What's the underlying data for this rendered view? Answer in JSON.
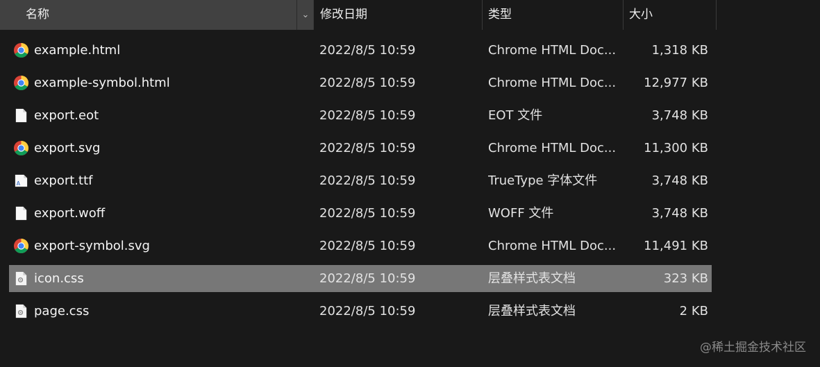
{
  "header": {
    "name": "名称",
    "modified": "修改日期",
    "type": "类型",
    "size": "大小",
    "sort_indicator": "^",
    "dropdown": "⌄"
  },
  "files": [
    {
      "name": "example.html",
      "modified": "2022/8/5 10:59",
      "type": "Chrome HTML Doc...",
      "size": "1,318 KB",
      "icon": "chrome-icon",
      "selected": false
    },
    {
      "name": "example-symbol.html",
      "modified": "2022/8/5 10:59",
      "type": "Chrome HTML Doc...",
      "size": "12,977 KB",
      "icon": "chrome-icon",
      "selected": false
    },
    {
      "name": "export.eot",
      "modified": "2022/8/5 10:59",
      "type": "EOT 文件",
      "size": "3,748 KB",
      "icon": "file-icon",
      "selected": false
    },
    {
      "name": "export.svg",
      "modified": "2022/8/5 10:59",
      "type": "Chrome HTML Doc...",
      "size": "11,300 KB",
      "icon": "chrome-icon",
      "selected": false
    },
    {
      "name": "export.ttf",
      "modified": "2022/8/5 10:59",
      "type": "TrueType 字体文件",
      "size": "3,748 KB",
      "icon": "font-file-icon",
      "selected": false
    },
    {
      "name": "export.woff",
      "modified": "2022/8/5 10:59",
      "type": "WOFF 文件",
      "size": "3,748 KB",
      "icon": "file-icon",
      "selected": false
    },
    {
      "name": "export-symbol.svg",
      "modified": "2022/8/5 10:59",
      "type": "Chrome HTML Doc...",
      "size": "11,491 KB",
      "icon": "chrome-icon",
      "selected": false
    },
    {
      "name": "icon.css",
      "modified": "2022/8/5 10:59",
      "type": "层叠样式表文档",
      "size": "323 KB",
      "icon": "css-file-icon",
      "selected": true
    },
    {
      "name": "page.css",
      "modified": "2022/8/5 10:59",
      "type": "层叠样式表文档",
      "size": "2 KB",
      "icon": "css-file-icon",
      "selected": false
    }
  ],
  "watermark": "@稀土掘金技术社区"
}
